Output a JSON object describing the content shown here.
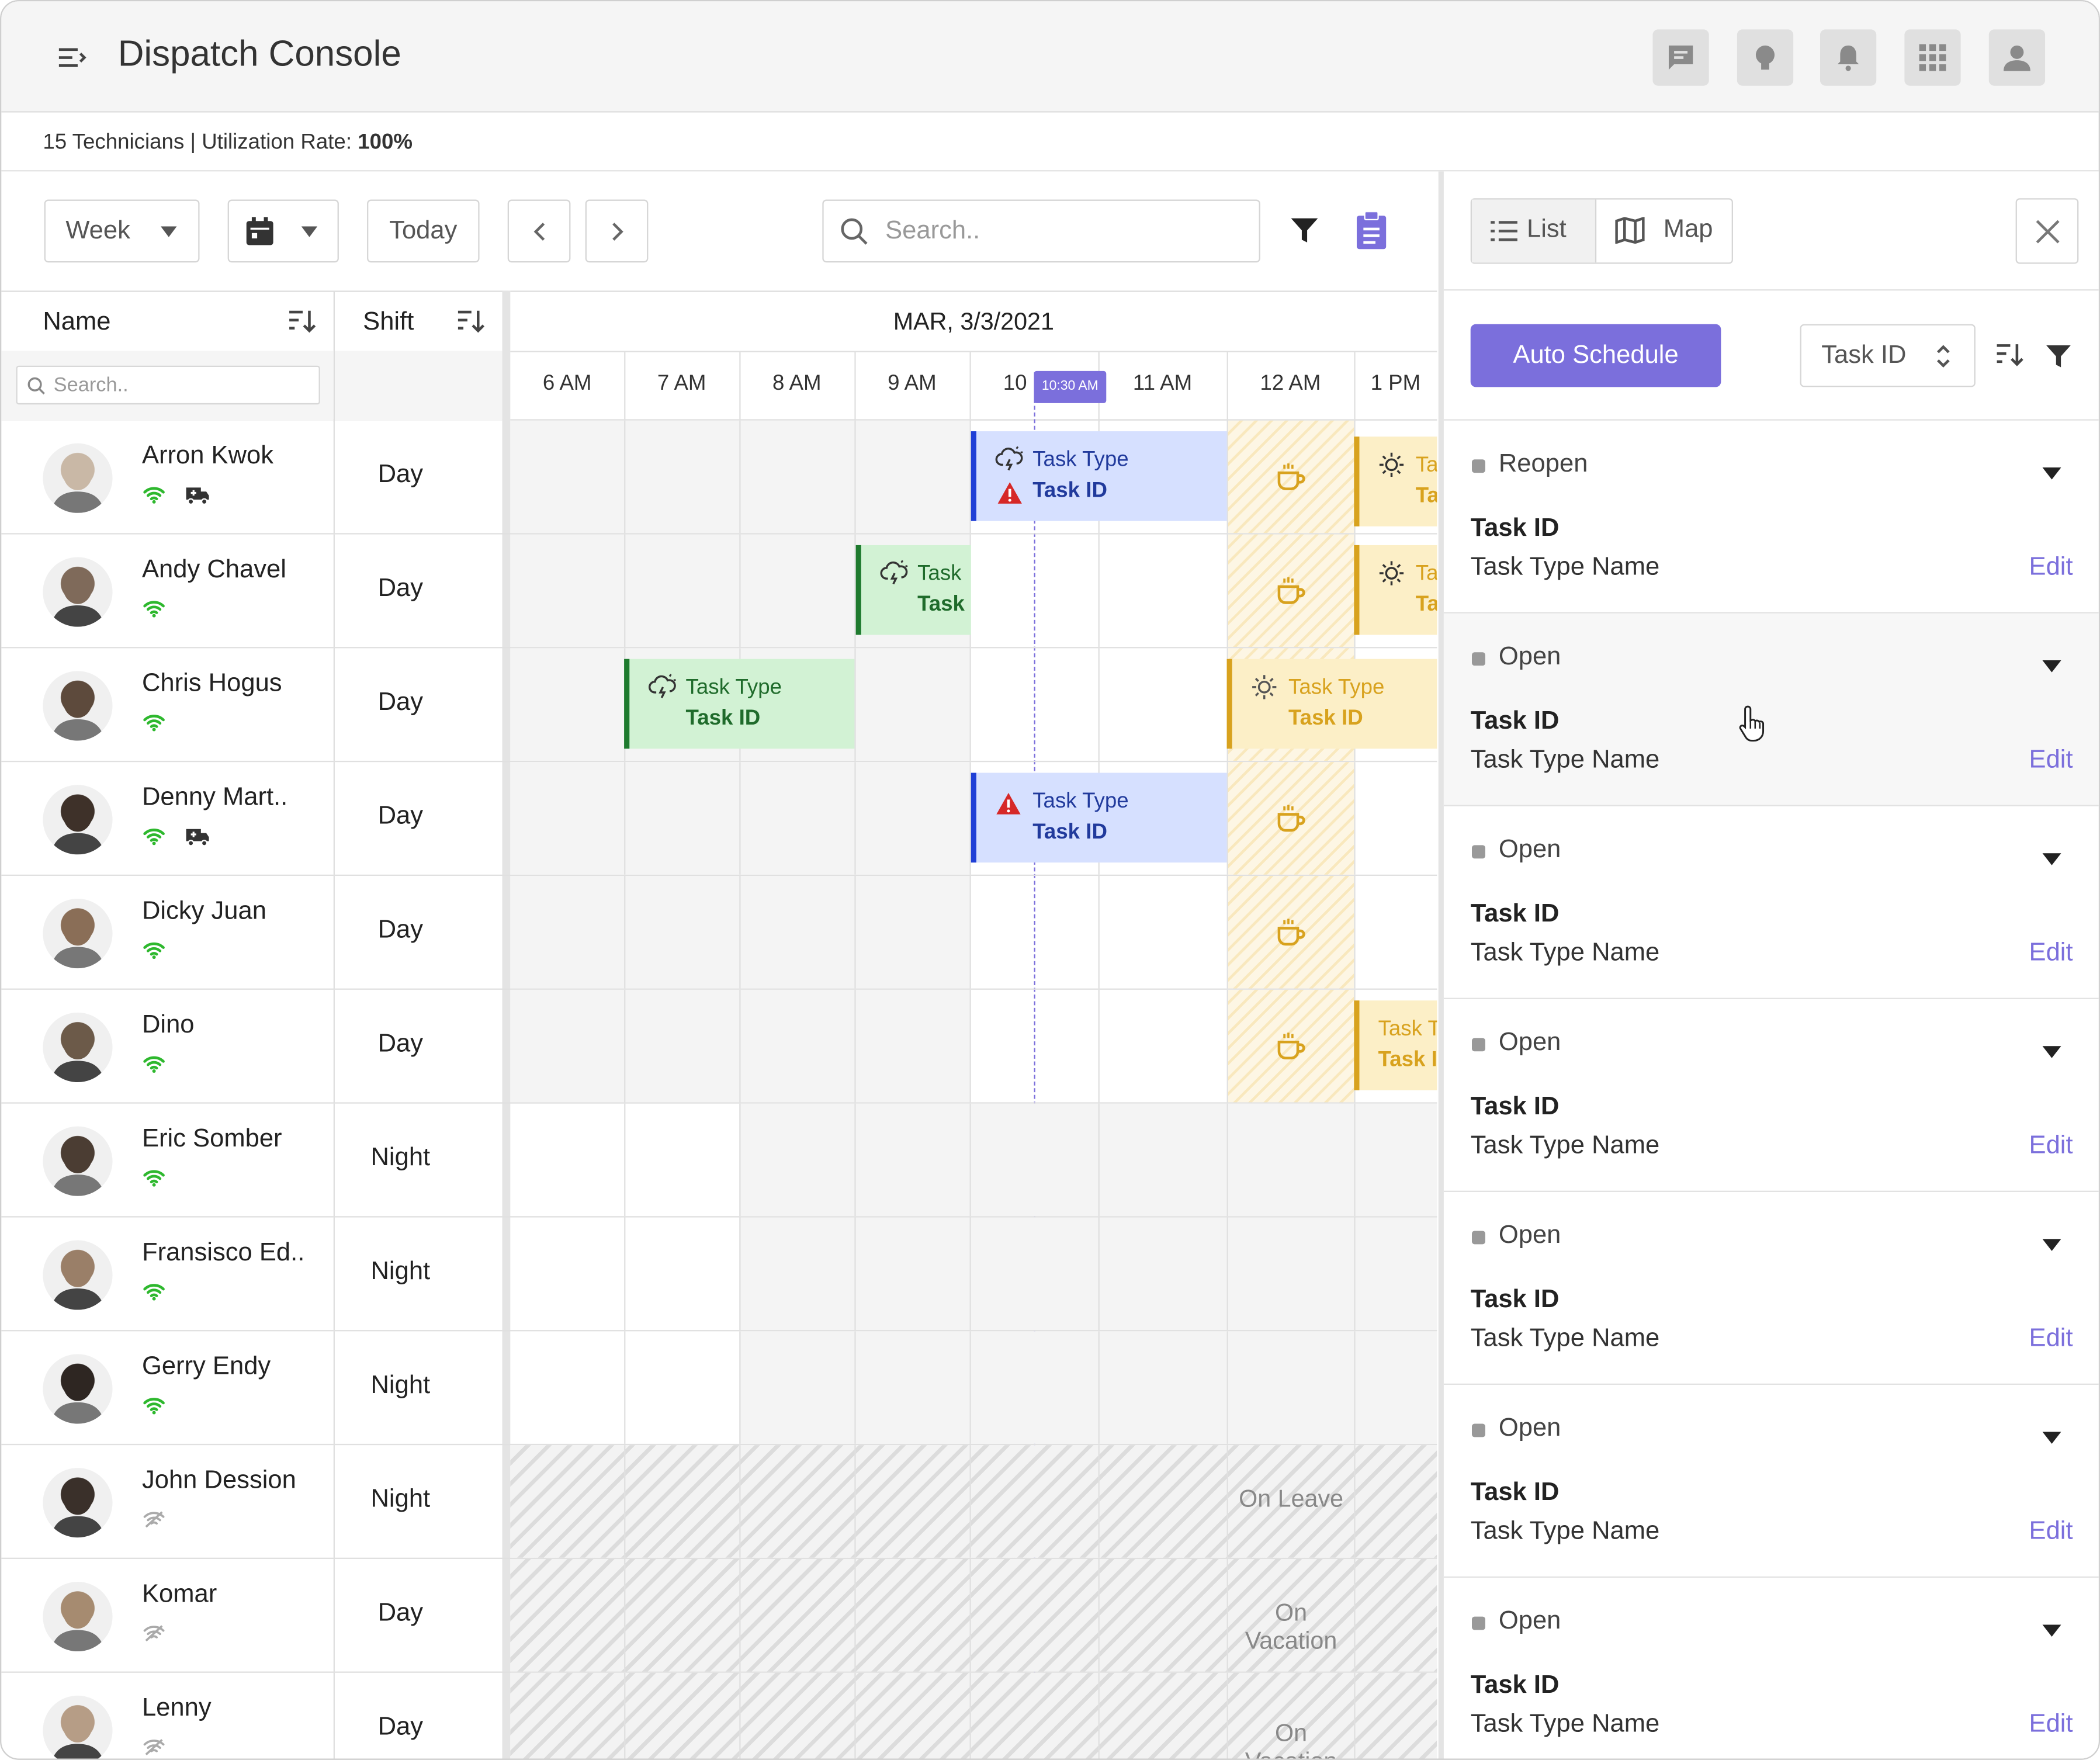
{
  "header": {
    "title": "Dispatch Console",
    "icons": [
      "menu-collapse-icon",
      "chat-icon",
      "lightbulb-icon",
      "bell-icon",
      "apps-grid-icon",
      "user-icon"
    ]
  },
  "summary": {
    "technicians": "15 Technicians | Utilization Rate: ",
    "rate": "100%"
  },
  "toolbar": {
    "view": "Week",
    "today": "Today",
    "search_placeholder": "Search.."
  },
  "grid": {
    "name_header": "Name",
    "shift_header": "Shift",
    "name_search_placeholder": "Search..",
    "date": "MAR, 3/3/2021",
    "hours": [
      "6 AM",
      "7 AM",
      "8 AM",
      "9 AM",
      "10",
      "11 AM",
      "12 AM",
      "1 PM"
    ],
    "now_label": "10:30 AM"
  },
  "technicians": [
    {
      "name": "Arron Kwok",
      "shift": "Day",
      "status": "online",
      "vehicle": true
    },
    {
      "name": "Andy Chavel",
      "shift": "Day",
      "status": "online",
      "vehicle": false
    },
    {
      "name": "Chris Hogus",
      "shift": "Day",
      "status": "online",
      "vehicle": false
    },
    {
      "name": "Denny Mart..",
      "shift": "Day",
      "status": "online",
      "vehicle": true
    },
    {
      "name": "Dicky Juan",
      "shift": "Day",
      "status": "online",
      "vehicle": false
    },
    {
      "name": "Dino",
      "shift": "Day",
      "status": "online",
      "vehicle": false
    },
    {
      "name": "Eric Somber",
      "shift": "Night",
      "status": "online",
      "vehicle": false
    },
    {
      "name": "Fransisco Ed..",
      "shift": "Night",
      "status": "online",
      "vehicle": false
    },
    {
      "name": "Gerry Endy",
      "shift": "Night",
      "status": "online",
      "vehicle": false
    },
    {
      "name": "John Dession",
      "shift": "Night",
      "status": "offline",
      "vehicle": false
    },
    {
      "name": "Komar",
      "shift": "Day",
      "status": "offline",
      "vehicle": false
    },
    {
      "name": "Lenny",
      "shift": "Day",
      "status": "offline",
      "vehicle": false
    }
  ],
  "tasks": {
    "type": "Task Type",
    "id": "Task ID",
    "type_short": "Task T",
    "id_short": "Task I",
    "type_cut": "Task ",
    "id_cut": "Task",
    "type_tiny": "Ta",
    "id_tiny": "Ta"
  },
  "absences": [
    "On Leave",
    "On Vacation",
    "On Vacation"
  ],
  "panel": {
    "list": "List",
    "map": "Map",
    "auto_schedule": "Auto Schedule",
    "sort_field": "Task ID",
    "cards": [
      {
        "status": "Reopen",
        "id": "Task ID",
        "type": "Task Type Name",
        "edit": "Edit"
      },
      {
        "status": "Open",
        "id": "Task ID",
        "type": "Task Type Name",
        "edit": "Edit"
      },
      {
        "status": "Open",
        "id": "Task ID",
        "type": "Task Type Name",
        "edit": "Edit"
      },
      {
        "status": "Open",
        "id": "Task ID",
        "type": "Task Type Name",
        "edit": "Edit"
      },
      {
        "status": "Open",
        "id": "Task ID",
        "type": "Task Type Name",
        "edit": "Edit"
      },
      {
        "status": "Open",
        "id": "Task ID",
        "type": "Task Type Name",
        "edit": "Edit"
      },
      {
        "status": "Open",
        "id": "Task ID",
        "type": "Task Type Name",
        "edit": "Edit"
      }
    ]
  },
  "colors": {
    "accent": "#7b6fdc",
    "online": "#2eb82e",
    "blue_task": "#d6e0ff",
    "green_task": "#d2f2d4",
    "yellow_task": "#fcefc7",
    "warning": "#d62828"
  }
}
